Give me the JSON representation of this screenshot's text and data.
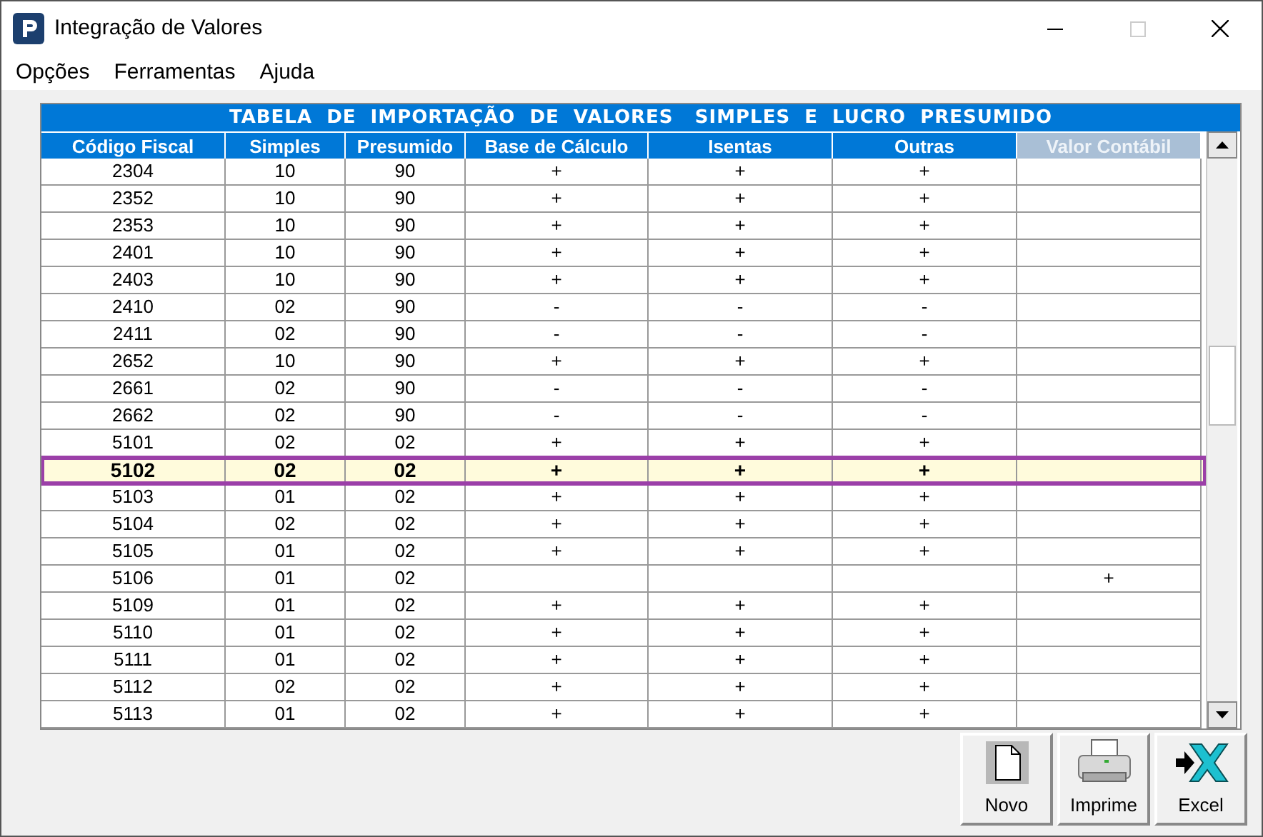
{
  "window": {
    "title": "Integração de Valores"
  },
  "menu": [
    "Opções",
    "Ferramentas",
    "Ajuda"
  ],
  "table": {
    "title": "TABELA  DE  IMPORTAÇÃO  DE  VALORES   SIMPLES  E  LUCRO  PRESUMIDO",
    "columns": [
      {
        "label": "Código Fiscal",
        "disabled": false
      },
      {
        "label": "Simples",
        "disabled": false
      },
      {
        "label": "Presumido",
        "disabled": false
      },
      {
        "label": "Base de Cálculo",
        "disabled": false
      },
      {
        "label": "Isentas",
        "disabled": false
      },
      {
        "label": "Outras",
        "disabled": false
      },
      {
        "label": "Valor Contábil",
        "disabled": true
      }
    ],
    "rows": [
      {
        "cells": [
          "2304",
          "10",
          "90",
          "+",
          "+",
          "+",
          ""
        ],
        "selected": false
      },
      {
        "cells": [
          "2352",
          "10",
          "90",
          "+",
          "+",
          "+",
          ""
        ],
        "selected": false
      },
      {
        "cells": [
          "2353",
          "10",
          "90",
          "+",
          "+",
          "+",
          ""
        ],
        "selected": false
      },
      {
        "cells": [
          "2401",
          "10",
          "90",
          "+",
          "+",
          "+",
          ""
        ],
        "selected": false
      },
      {
        "cells": [
          "2403",
          "10",
          "90",
          "+",
          "+",
          "+",
          ""
        ],
        "selected": false
      },
      {
        "cells": [
          "2410",
          "02",
          "90",
          "-",
          "-",
          "-",
          ""
        ],
        "selected": false
      },
      {
        "cells": [
          "2411",
          "02",
          "90",
          "-",
          "-",
          "-",
          ""
        ],
        "selected": false
      },
      {
        "cells": [
          "2652",
          "10",
          "90",
          "+",
          "+",
          "+",
          ""
        ],
        "selected": false
      },
      {
        "cells": [
          "2661",
          "02",
          "90",
          "-",
          "-",
          "-",
          ""
        ],
        "selected": false
      },
      {
        "cells": [
          "2662",
          "02",
          "90",
          "-",
          "-",
          "-",
          ""
        ],
        "selected": false
      },
      {
        "cells": [
          "5101",
          "02",
          "02",
          "+",
          "+",
          "+",
          ""
        ],
        "selected": false
      },
      {
        "cells": [
          "5102",
          "02",
          "02",
          "+",
          "+",
          "+",
          ""
        ],
        "selected": true
      },
      {
        "cells": [
          "5103",
          "01",
          "02",
          "+",
          "+",
          "+",
          ""
        ],
        "selected": false
      },
      {
        "cells": [
          "5104",
          "02",
          "02",
          "+",
          "+",
          "+",
          ""
        ],
        "selected": false
      },
      {
        "cells": [
          "5105",
          "01",
          "02",
          "+",
          "+",
          "+",
          ""
        ],
        "selected": false
      },
      {
        "cells": [
          "5106",
          "01",
          "02",
          "",
          "",
          "",
          "+"
        ],
        "selected": false
      },
      {
        "cells": [
          "5109",
          "01",
          "02",
          "+",
          "+",
          "+",
          ""
        ],
        "selected": false
      },
      {
        "cells": [
          "5110",
          "01",
          "02",
          "+",
          "+",
          "+",
          ""
        ],
        "selected": false
      },
      {
        "cells": [
          "5111",
          "01",
          "02",
          "+",
          "+",
          "+",
          ""
        ],
        "selected": false
      },
      {
        "cells": [
          "5112",
          "02",
          "02",
          "+",
          "+",
          "+",
          ""
        ],
        "selected": false
      },
      {
        "cells": [
          "5113",
          "01",
          "02",
          "+",
          "+",
          "+",
          ""
        ],
        "selected": false
      }
    ]
  },
  "buttons": [
    {
      "kind": "new",
      "label": "Novo"
    },
    {
      "kind": "print",
      "label": "Imprime"
    },
    {
      "kind": "excel",
      "label": "Excel"
    }
  ]
}
